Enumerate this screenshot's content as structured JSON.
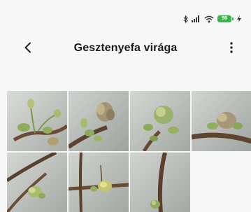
{
  "status_bar": {
    "icons": [
      "bluetooth-icon",
      "signal-icon",
      "wifi-icon",
      "battery-icon",
      "charging-icon"
    ],
    "battery_level": "98",
    "battery_color": "#3bb54a"
  },
  "header": {
    "title": "Gesztenyefa virága",
    "back_icon": "back-arrow-icon",
    "more_icon": "more-vertical-icon"
  },
  "gallery": {
    "photos": [
      {
        "subject": "chestnut-flower-bud"
      },
      {
        "subject": "chestnut-flower-bud"
      },
      {
        "subject": "chestnut-flower-bud"
      },
      {
        "subject": "chestnut-flower-bud"
      },
      {
        "subject": "chestnut-flower-bud"
      },
      {
        "subject": "chestnut-flower-bud"
      },
      {
        "subject": "chestnut-flower-bud"
      }
    ]
  }
}
